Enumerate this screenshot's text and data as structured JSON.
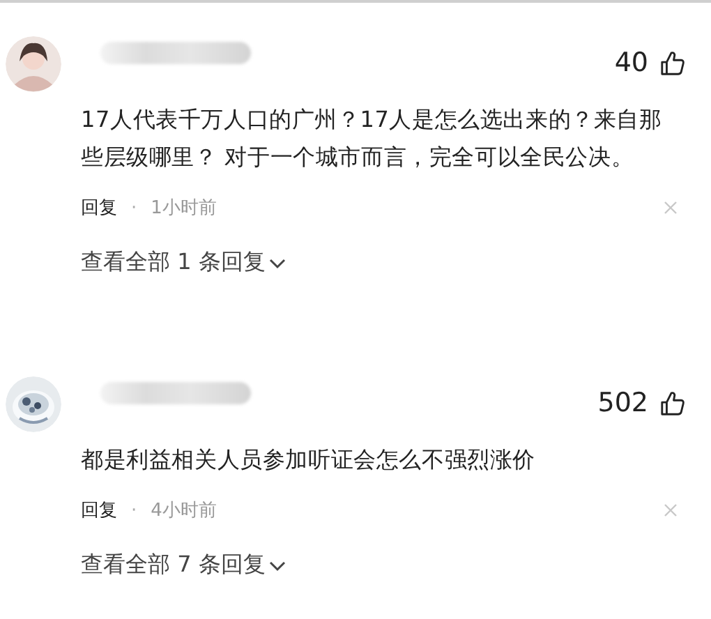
{
  "comments": [
    {
      "avatar": {
        "kind": "person"
      },
      "likes": "40",
      "text": "17人代表千万人口的广州？17人是怎么选出来的？来自那些层级哪里？ 对于一个城市而言，完全可以全民公决。",
      "reply": "回复",
      "separator": "·",
      "time": "1小时前",
      "view_replies": "查看全部 1 条回复"
    },
    {
      "likes": "502",
      "text": "都是利益相关人员参加听证会怎么不强烈涨价",
      "reply": "回复",
      "separator": "·",
      "time": "4小时前",
      "view_replies": "查看全部 7 条回复"
    }
  ]
}
